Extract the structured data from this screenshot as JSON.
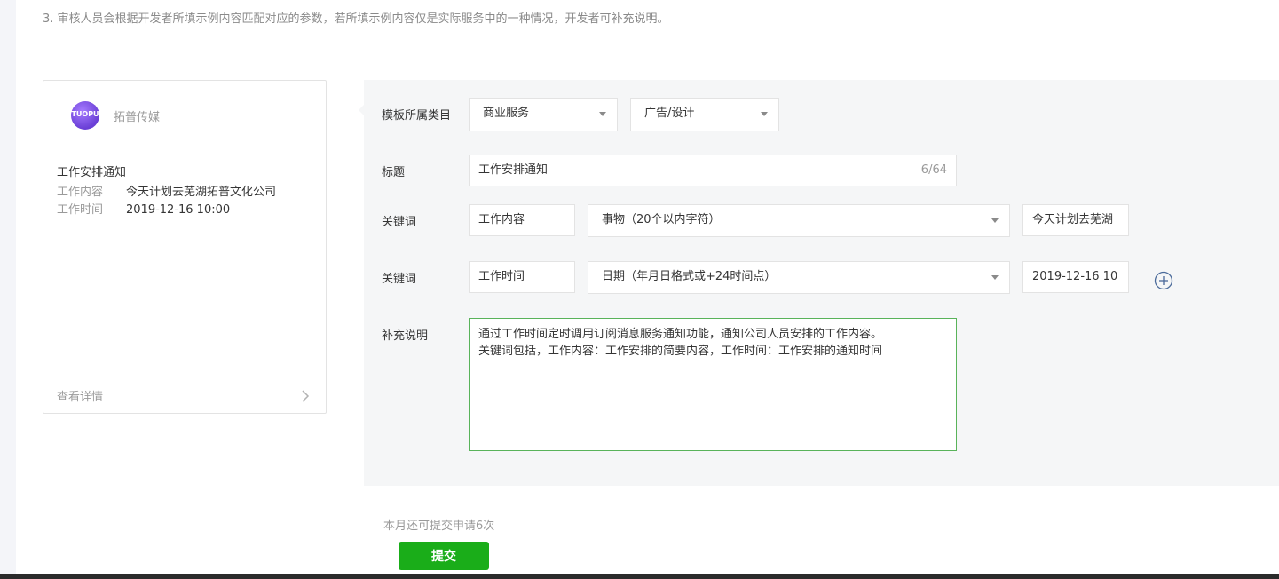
{
  "notice": "3. 审核人员会根据开发者所填示例内容匹配对应的参数，若所填示例内容仅是实际服务中的一种情况，开发者可补充说明。",
  "preview": {
    "logo_text": "TUOPU",
    "brand": "拓普传媒",
    "title": "工作安排通知",
    "rows": [
      {
        "key": "工作内容",
        "value": "今天计划去芜湖拓普文化公司"
      },
      {
        "key": "工作时间",
        "value": "2019-12-16 10:00"
      }
    ],
    "detail_link": "查看详情"
  },
  "form": {
    "category": {
      "label": "模板所属类目",
      "primary": "商业服务",
      "secondary": "广告/设计"
    },
    "title": {
      "label": "标题",
      "value": "工作安排通知",
      "counter": "6/64"
    },
    "keywords": [
      {
        "label": "关键词",
        "name": "工作内容",
        "type": "事物（20个以内字符）",
        "example": "今天计划去芜湖"
      },
      {
        "label": "关键词",
        "name": "工作时间",
        "type": "日期（年月日格式或+24时间点）",
        "example": "2019-12-16 10"
      }
    ],
    "supplement": {
      "label": "补充说明",
      "lines": [
        "通过工作时间定时调用订阅消息服务通知功能，通知公司人员安排的工作内容。",
        "关键词包括，工作内容：工作安排的简要内容，工作时间：工作安排的通知时间"
      ]
    }
  },
  "quota_text": "本月还可提交申请6次",
  "submit_label": "提交",
  "colors": {
    "accent": "#1aad19",
    "focus_border": "#59b35a",
    "panel_bg": "#f5f6f7"
  }
}
